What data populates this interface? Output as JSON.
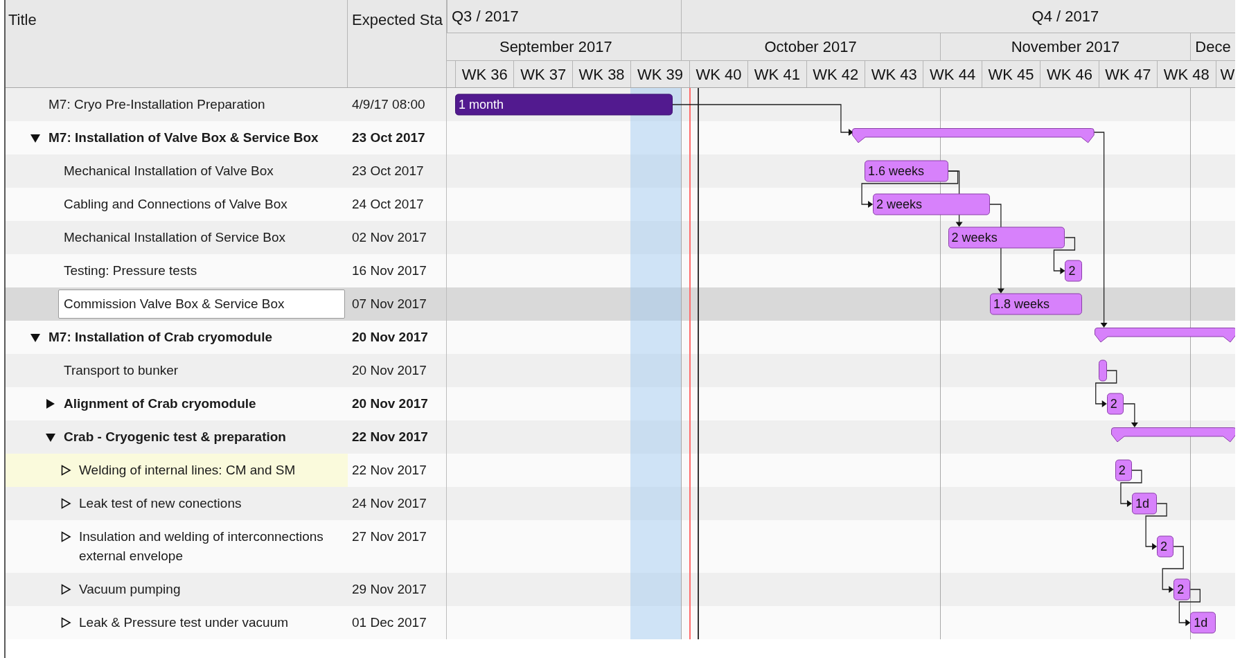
{
  "table": {
    "columns": [
      {
        "label": "Title"
      },
      {
        "label": "Expected Sta"
      }
    ]
  },
  "timeline": {
    "quarters": [
      {
        "label": "Q3 / 2017"
      },
      {
        "label": "Q4 / 2017"
      }
    ],
    "months": [
      {
        "label": "September 2017"
      },
      {
        "label": "October 2017"
      },
      {
        "label": "November 2017"
      },
      {
        "label": "Dece"
      }
    ],
    "weeks": [
      {
        "label": "WK 36"
      },
      {
        "label": "WK 37"
      },
      {
        "label": "WK 38"
      },
      {
        "label": "WK 39"
      },
      {
        "label": "WK 40"
      },
      {
        "label": "WK 41"
      },
      {
        "label": "WK 42"
      },
      {
        "label": "WK 43"
      },
      {
        "label": "WK 44"
      },
      {
        "label": "WK 45"
      },
      {
        "label": "WK 46"
      },
      {
        "label": "WK 47"
      },
      {
        "label": "WK 48"
      },
      {
        "label": "W"
      }
    ]
  },
  "rows": [
    {
      "title": "M7: Cryo Pre-Installation Preparation",
      "date": "4/9/17 08:00",
      "kind": "task",
      "selected": false,
      "highlighted": false,
      "bar": {
        "kind": "done",
        "label": "1 month"
      }
    },
    {
      "title": "M7: Installation of Valve Box & Service Box",
      "date": "23 Oct 2017",
      "kind": "summary",
      "expanded": true,
      "selected": false,
      "highlighted": false,
      "bar": {
        "kind": "summary"
      },
      "children": [
        {
          "title": "Mechanical Installation of Valve Box",
          "date": "23 Oct 2017",
          "kind": "task",
          "selected": false,
          "highlighted": false,
          "bar": {
            "kind": "task",
            "label": "1.6 weeks"
          }
        },
        {
          "title": "Cabling and Connections of Valve Box",
          "date": "24 Oct 2017",
          "kind": "task",
          "selected": false,
          "highlighted": false,
          "bar": {
            "kind": "task",
            "label": "2 weeks"
          }
        },
        {
          "title": "Mechanical Installation of Service Box",
          "date": "02 Nov 2017",
          "kind": "task",
          "selected": false,
          "highlighted": false,
          "bar": {
            "kind": "task",
            "label": "2 weeks"
          }
        },
        {
          "title": "Testing: Pressure tests",
          "date": "16 Nov 2017",
          "kind": "task",
          "selected": false,
          "highlighted": false,
          "bar": {
            "kind": "task",
            "label": "2"
          }
        },
        {
          "title": "Commission Valve Box & Service Box",
          "date": "07 Nov 2017",
          "kind": "task",
          "selected": true,
          "highlighted": false,
          "bar": {
            "kind": "task",
            "label": "1.8 weeks"
          }
        }
      ]
    },
    {
      "title": "M7: Installation of Crab cryomodule",
      "date": "20 Nov 2017",
      "kind": "summary",
      "expanded": true,
      "selected": false,
      "highlighted": false,
      "bar": {
        "kind": "summary"
      },
      "children": [
        {
          "title": "Transport to bunker",
          "date": "20 Nov 2017",
          "kind": "task",
          "selected": false,
          "highlighted": false,
          "bar": {
            "kind": "task"
          }
        },
        {
          "title": "Alignment of  Crab cryomodule",
          "date": "20 Nov 2017",
          "kind": "summary",
          "expanded": false,
          "selected": false,
          "highlighted": false,
          "bar": {
            "kind": "task",
            "label": "2"
          }
        },
        {
          "title": "Crab - Cryogenic test & preparation",
          "date": "22 Nov 2017",
          "kind": "summary",
          "expanded": true,
          "selected": false,
          "highlighted": false,
          "bar": {
            "kind": "summary"
          },
          "children": [
            {
              "title": "Welding of internal lines: CM and SM",
              "date": "22 Nov 2017",
              "kind": "outline",
              "expanded": false,
              "selected": false,
              "highlighted": true,
              "bar": {
                "kind": "task",
                "label": "2"
              }
            },
            {
              "title": "Leak test of new conections",
              "date": "24 Nov 2017",
              "kind": "outline",
              "expanded": false,
              "selected": false,
              "highlighted": false,
              "bar": {
                "kind": "task",
                "label": "1d"
              }
            },
            {
              "title": "Insulation and welding of interconnections external envelope",
              "date": "27 Nov 2017",
              "kind": "outline",
              "expanded": false,
              "selected": false,
              "highlighted": false,
              "bar": {
                "kind": "task",
                "label": "2"
              }
            },
            {
              "title": "Vacuum pumping",
              "date": "29 Nov 2017",
              "kind": "outline",
              "expanded": false,
              "selected": false,
              "highlighted": false,
              "bar": {
                "kind": "task",
                "label": "2"
              }
            },
            {
              "title": "Leak & Pressure test under vacuum",
              "date": "01 Dec 2017",
              "kind": "outline",
              "expanded": false,
              "selected": false,
              "highlighted": false,
              "bar": {
                "kind": "task",
                "label": "1d"
              }
            }
          ]
        }
      ]
    }
  ]
}
